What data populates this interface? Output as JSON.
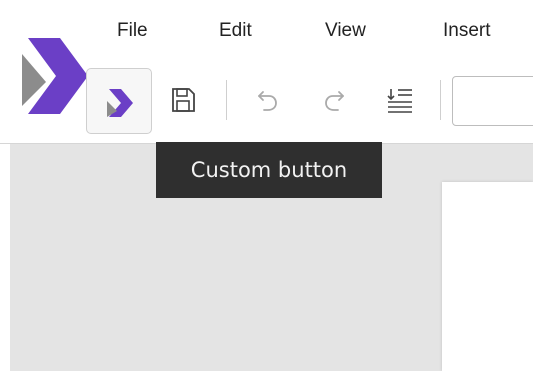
{
  "menu": {
    "items": [
      "File",
      "Edit",
      "View",
      "Insert"
    ]
  },
  "toolbar": {
    "buttons": [
      {
        "name": "custom-button",
        "icon": "app-logo-icon"
      },
      {
        "name": "save-button",
        "icon": "save-icon"
      },
      {
        "name": "undo-button",
        "icon": "undo-icon"
      },
      {
        "name": "redo-button",
        "icon": "redo-icon"
      },
      {
        "name": "paragraph-button",
        "icon": "paragraph-list-icon"
      }
    ],
    "input_value": ""
  },
  "tooltip": {
    "text": "Custom button"
  },
  "colors": {
    "brand": "#6b3fc6",
    "brand_light": "#8a63d8",
    "workspace_bg": "#e4e4e4",
    "tooltip_bg": "#2f2f2f"
  }
}
